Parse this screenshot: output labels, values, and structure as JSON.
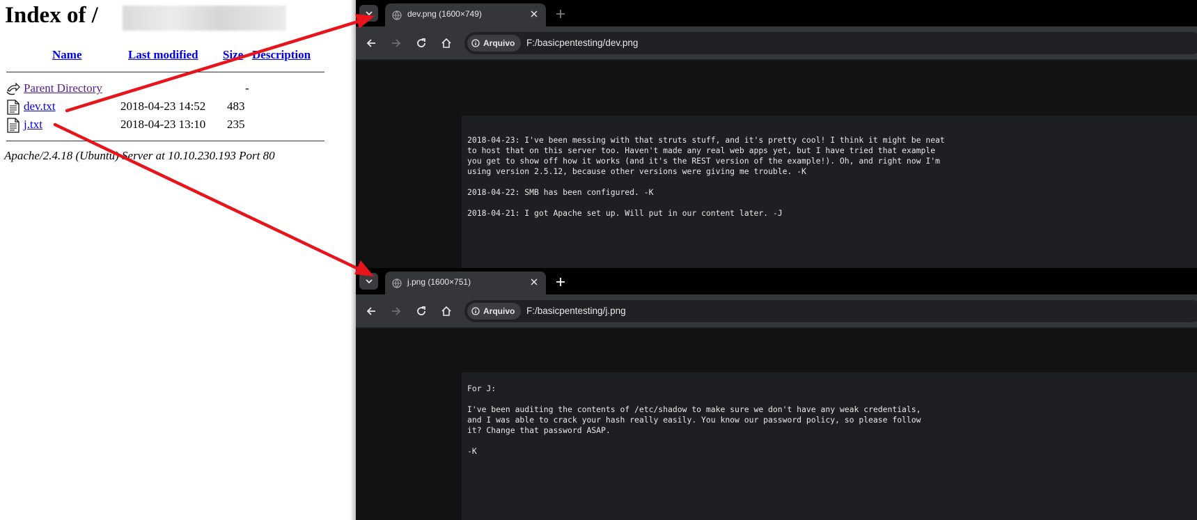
{
  "listing": {
    "title": "Index of /",
    "columns": {
      "name": "Name",
      "modified": "Last modified",
      "size": "Size",
      "description": "Description"
    },
    "rows": [
      {
        "name": "Parent Directory",
        "modified": "",
        "size": "-"
      },
      {
        "name": "dev.txt",
        "modified": "2018-04-23 14:52",
        "size": "483"
      },
      {
        "name": "j.txt",
        "modified": "2018-04-23 13:10",
        "size": "235"
      }
    ],
    "address": "Apache/2.4.18 (Ubuntu) Server at 10.10.230.193 Port 80"
  },
  "window1": {
    "tab_title": "dev.png (1600×749)",
    "security_chip": "Arquivo",
    "url": "F:/basicpentesting/dev.png",
    "text": "2018-04-23: I've been messing with that struts stuff, and it's pretty cool! I think it might be neat\nto host that on this server too. Haven't made any real web apps yet, but I have tried that example\nyou get to show off how it works (and it's the REST version of the example!). Oh, and right now I'm\nusing version 2.5.12, because other versions were giving me trouble. -K\n\n2018-04-22: SMB has been configured. -K\n\n2018-04-21: I got Apache set up. Will put in our content later. -J"
  },
  "window2": {
    "tab_title": "j.png (1600×751)",
    "security_chip": "Arquivo",
    "url": "F:/basicpentesting/j.png",
    "text": "For J:\n\nI've been auditing the contents of /etc/shadow to make sure we don't have any weak credentials,\nand I was able to crack your hash really easily. You know our password policy, so please follow\nit? Change that password ASAP.\n\n-K"
  },
  "icons": {
    "parent": "back-arrow-icon",
    "file": "text-file-icon",
    "tab_list": "chevron-down-icon",
    "tab_favicon": "globe-icon",
    "tab_close": "close-icon",
    "new_tab": "plus-icon",
    "back": "arrow-left-icon",
    "forward": "arrow-right-icon",
    "reload": "reload-icon",
    "home": "home-icon",
    "security": "info-icon"
  },
  "colors": {
    "link": "#0000ee",
    "visited": "#551a8b",
    "arrow": "#e8141c",
    "browser_bg": "#1c1b21"
  }
}
